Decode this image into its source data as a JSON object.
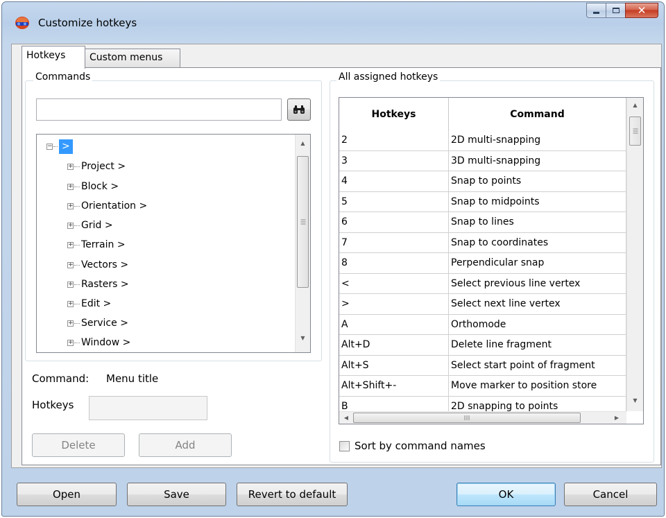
{
  "window": {
    "title": "Customize hotkeys"
  },
  "tabs": [
    {
      "label": "Hotkeys",
      "active": true
    },
    {
      "label": "Custom menus",
      "active": false
    }
  ],
  "commands_group": {
    "label": "Commands",
    "search_value": "",
    "search_icon": "binoculars-icon",
    "tree": {
      "root_label": ">",
      "items": [
        "Project >",
        "Block >",
        "Orientation >",
        "Grid >",
        "Terrain >",
        "Vectors >",
        "Rasters >",
        "Edit >",
        "Service >",
        "Window >"
      ]
    },
    "command_label": "Command:",
    "command_value": "Menu title",
    "hotkeys_label": "Hotkeys",
    "hotkeys_value": "",
    "delete_label": "Delete",
    "add_label": "Add"
  },
  "assigned_group": {
    "label": "All assigned hotkeys",
    "columns": [
      "Hotkeys",
      "Command"
    ],
    "rows": [
      {
        "hotkey": "2",
        "command": "2D multi-snapping"
      },
      {
        "hotkey": "3",
        "command": "3D multi-snapping"
      },
      {
        "hotkey": "4",
        "command": "Snap to points"
      },
      {
        "hotkey": "5",
        "command": "Snap to midpoints"
      },
      {
        "hotkey": "6",
        "command": "Snap to lines"
      },
      {
        "hotkey": "7",
        "command": "Snap to coordinates"
      },
      {
        "hotkey": "8",
        "command": "Perpendicular snap"
      },
      {
        "hotkey": "<",
        "command": "Select previous line vertex"
      },
      {
        "hotkey": ">",
        "command": "Select next line vertex"
      },
      {
        "hotkey": "A",
        "command": "Orthomode"
      },
      {
        "hotkey": "Alt+D",
        "command": "Delete line fragment"
      },
      {
        "hotkey": "Alt+S",
        "command": "Select start point of fragment"
      },
      {
        "hotkey": "Alt+Shift+-",
        "command": "Move marker to position store"
      },
      {
        "hotkey": "B",
        "command": "2D snapping to points"
      }
    ],
    "sort_label": "Sort by command names",
    "sort_checked": false
  },
  "footer": {
    "open_label": "Open",
    "save_label": "Save",
    "revert_label": "Revert to default",
    "ok_label": "OK",
    "cancel_label": "Cancel"
  }
}
